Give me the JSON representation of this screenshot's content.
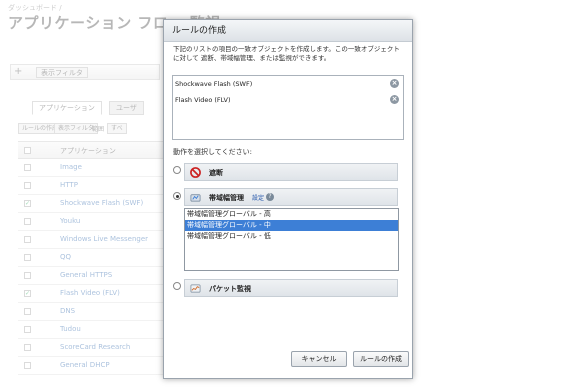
{
  "background": {
    "breadcrumb": "ダッシュボード /",
    "page_title": "アプリケーション フロー 監視",
    "filter": {
      "add_symbol": "+",
      "button_label": "表示フィルタ"
    },
    "tabs": [
      "アプリケーション",
      "ユーザ"
    ],
    "toolbar": {
      "create_rule": "ルールの作成",
      "view_filter": "表示フィルタ",
      "label": "範囲",
      "select_value": "すべ"
    },
    "grid": {
      "header": "アプリケーション",
      "rows": [
        {
          "name": "Image",
          "checked": false
        },
        {
          "name": "HTTP",
          "checked": false
        },
        {
          "name": "Shockwave Flash (SWF)",
          "checked": true
        },
        {
          "name": "Youku",
          "checked": false
        },
        {
          "name": "Windows Live Messenger",
          "checked": false
        },
        {
          "name": "QQ",
          "checked": false
        },
        {
          "name": "General HTTPS",
          "checked": false
        },
        {
          "name": "Flash Video (FLV)",
          "checked": true
        },
        {
          "name": "DNS",
          "checked": false
        },
        {
          "name": "Tudou",
          "checked": false
        },
        {
          "name": "ScoreCard Research",
          "checked": false
        },
        {
          "name": "General DHCP",
          "checked": false
        }
      ]
    }
  },
  "modal": {
    "title": "ルールの作成",
    "description": "下記のリストの項目の一致オブジェクトを作成します。この一致オブジェクトに対して 遮断、帯域幅管理、または監視ができます。",
    "objects": [
      "Shockwave Flash (SWF)",
      "Flash Video (FLV)"
    ],
    "remove_symbol": "×",
    "action_prompt": "動作を選択してください:",
    "actions": {
      "block": {
        "label": "遮断",
        "selected": false
      },
      "bandwidth": {
        "label": "帯域幅管理",
        "settings_link": "設定",
        "help_symbol": "?",
        "selected": true
      },
      "monitor": {
        "label": "パケット監視",
        "selected": false
      }
    },
    "bandwidth_options": [
      {
        "label": "帯域幅管理グローバル - 高",
        "selected": false
      },
      {
        "label": "帯域幅管理グローバル - 中",
        "selected": true
      },
      {
        "label": "帯域幅管理グローバル - 低",
        "selected": false
      }
    ],
    "buttons": {
      "cancel": "キャンセル",
      "create": "ルールの作成"
    }
  },
  "colors": {
    "selection": "#3d7fd6",
    "block_red": "#cc2222",
    "link": "#2255aa"
  }
}
